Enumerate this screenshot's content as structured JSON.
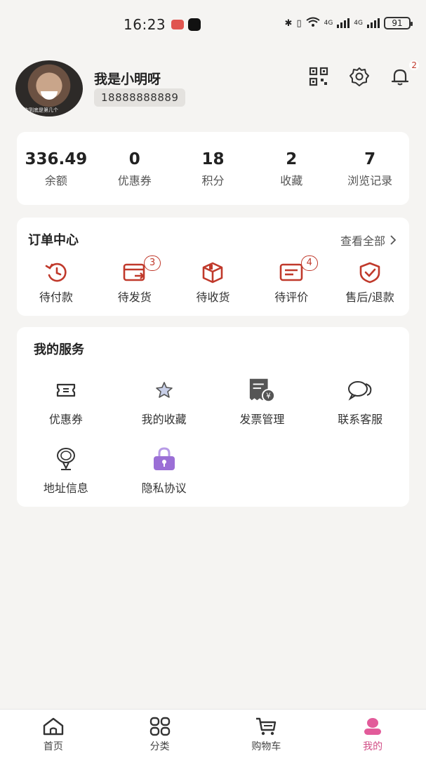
{
  "status_bar": {
    "time": "16:23",
    "network_1": "4G",
    "network_2": "4G",
    "battery": "91"
  },
  "profile": {
    "username": "我是小明呀",
    "phone": "18888888889",
    "avatar_caption": "你到底是第几个",
    "notification_count": "2"
  },
  "stats": [
    {
      "value": "336.49",
      "label": "余额"
    },
    {
      "value": "0",
      "label": "优惠券"
    },
    {
      "value": "18",
      "label": "积分"
    },
    {
      "value": "2",
      "label": "收藏"
    },
    {
      "value": "7",
      "label": "浏览记录"
    }
  ],
  "orders": {
    "title": "订单中心",
    "view_all": "查看全部",
    "items": [
      {
        "label": "待付款",
        "icon": "clock-icon"
      },
      {
        "label": "待发货",
        "icon": "card-send-icon",
        "badge": "3"
      },
      {
        "label": "待收货",
        "icon": "box-icon"
      },
      {
        "label": "待评价",
        "icon": "comment-icon",
        "badge": "4"
      },
      {
        "label": "售后/退款",
        "icon": "shield-check-icon"
      }
    ]
  },
  "services": {
    "title": "我的服务",
    "items": [
      {
        "label": "优惠券",
        "icon": "ticket-icon"
      },
      {
        "label": "我的收藏",
        "icon": "star-icon"
      },
      {
        "label": "发票管理",
        "icon": "invoice-icon"
      },
      {
        "label": "联系客服",
        "icon": "chat-bubbles-icon"
      },
      {
        "label": "地址信息",
        "icon": "location-icon"
      },
      {
        "label": "隐私协议",
        "icon": "lock-icon"
      }
    ]
  },
  "tabbar": [
    {
      "label": "首页",
      "icon": "home-icon"
    },
    {
      "label": "分类",
      "icon": "grid-icon"
    },
    {
      "label": "购物车",
      "icon": "cart-icon"
    },
    {
      "label": "我的",
      "icon": "user-icon",
      "active": true
    }
  ],
  "colors": {
    "accent_red": "#c0392b",
    "tab_active": "#d14f87",
    "privacy_purple": "#9b6fd6"
  }
}
